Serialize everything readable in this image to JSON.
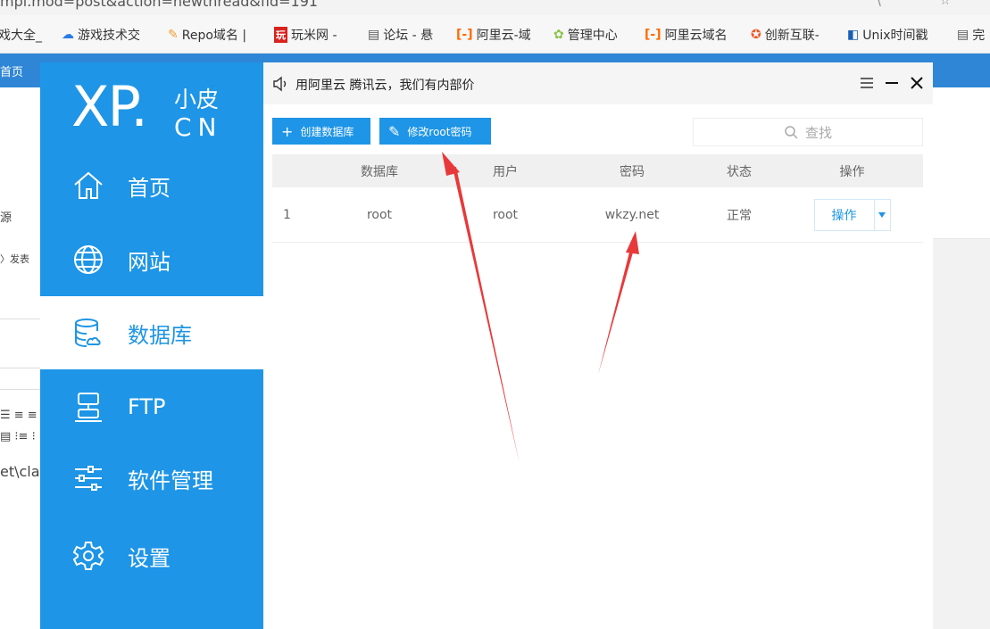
{
  "browser": {
    "url_fragment": "mpl.mod=post&action=newthread&fid=191",
    "bookmarks": [
      {
        "icon": "bookmark-icon",
        "label": "戏大全_"
      },
      {
        "icon": "cloud-icon",
        "label": "游戏技术交"
      },
      {
        "icon": "repo-icon",
        "label": "Repo域名 |"
      },
      {
        "icon": "wanmi-icon",
        "label": "玩米网 -"
      },
      {
        "icon": "page-icon",
        "label": "论坛 - 悬"
      },
      {
        "icon": "aliyun-icon",
        "label": "阿里云-域"
      },
      {
        "icon": "admin-icon",
        "label": "管理中心"
      },
      {
        "icon": "aliyun-icon",
        "label": "阿里云域名"
      },
      {
        "icon": "chuangxin-icon",
        "label": "创新互联-"
      },
      {
        "icon": "unix-icon",
        "label": "Unix时间戳"
      },
      {
        "icon": "page-icon",
        "label": "完"
      }
    ],
    "nav_label": "首页",
    "left_fragments": [
      "源",
      "〉发表",
      "et\\clas"
    ]
  },
  "app": {
    "logo": {
      "main": "XP.",
      "top": "小皮",
      "bottom": "CN"
    },
    "nav": [
      {
        "label": "首页",
        "icon": "home-icon"
      },
      {
        "label": "网站",
        "icon": "globe-icon"
      },
      {
        "label": "数据库",
        "icon": "database-icon",
        "active": true
      },
      {
        "label": "FTP",
        "icon": "ftp-icon"
      },
      {
        "label": "软件管理",
        "icon": "sliders-icon"
      },
      {
        "label": "设置",
        "icon": "gear-icon"
      }
    ],
    "notice": "用阿里云 腾讯云，我们有内部价",
    "toolbar": {
      "create_label": "创建数据库",
      "modify_label": "修改root密码",
      "search_placeholder": "查找"
    },
    "table": {
      "headers": [
        "",
        "数据库",
        "用户",
        "密码",
        "状态",
        "操作"
      ],
      "rows": [
        {
          "index": "1",
          "database": "root",
          "user": "root",
          "password": "wkzy.net",
          "status": "正常",
          "action": "操作"
        }
      ]
    },
    "colors": {
      "accent": "#1e95e6",
      "annotation": "#e8393a"
    }
  }
}
